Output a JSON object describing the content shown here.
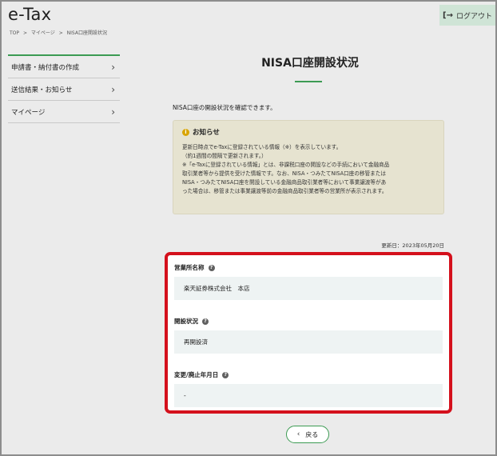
{
  "header": {
    "logo": "e-Tax",
    "logout_label": "ログアウト",
    "logout_icon": "logout-icon"
  },
  "breadcrumb": [
    "TOP",
    ">",
    "マイページ",
    ">",
    "NISA口座開設状況"
  ],
  "sidebar": {
    "items": [
      {
        "label": "申請書・納付書の作成"
      },
      {
        "label": "送信結果・お知らせ"
      },
      {
        "label": "マイページ"
      }
    ]
  },
  "main": {
    "title": "NISA口座開設状況",
    "intro": "NISA口座の開設状況を確認できます。",
    "notice": {
      "title": "お知らせ",
      "lines": [
        "更新日時点でe-Taxに登録されている情報（※）を表示しています。",
        "（約1週間の間隔で更新されます。）",
        "※「e-Taxに登録されている情報」とは、非課税口座の開設などの手続において金融商品",
        "取引業者等から提供を受けた情報です。なお、NISA・つみたてNISA口座の移管または",
        "NISA・つみたてNISA口座を開設している金融商品取引業者等において事業譲渡等があ",
        "った場合は、移管または事業譲渡等前の金融商品取引業者等の営業所が表示されます。"
      ]
    },
    "updated": "更新日：2023年05月20日",
    "fields": [
      {
        "label": "営業所名称",
        "value": "楽天証券株式会社　本店"
      },
      {
        "label": "開設状況",
        "value": "再開設済"
      },
      {
        "label": "変更/廃止年月日",
        "value": "-"
      }
    ],
    "back_label": "戻る"
  },
  "colors": {
    "accent_green": "#3c9b53",
    "highlight_red": "#d4101c",
    "notice_bg": "#e6e3d0",
    "page_bg": "#ebebeb"
  }
}
